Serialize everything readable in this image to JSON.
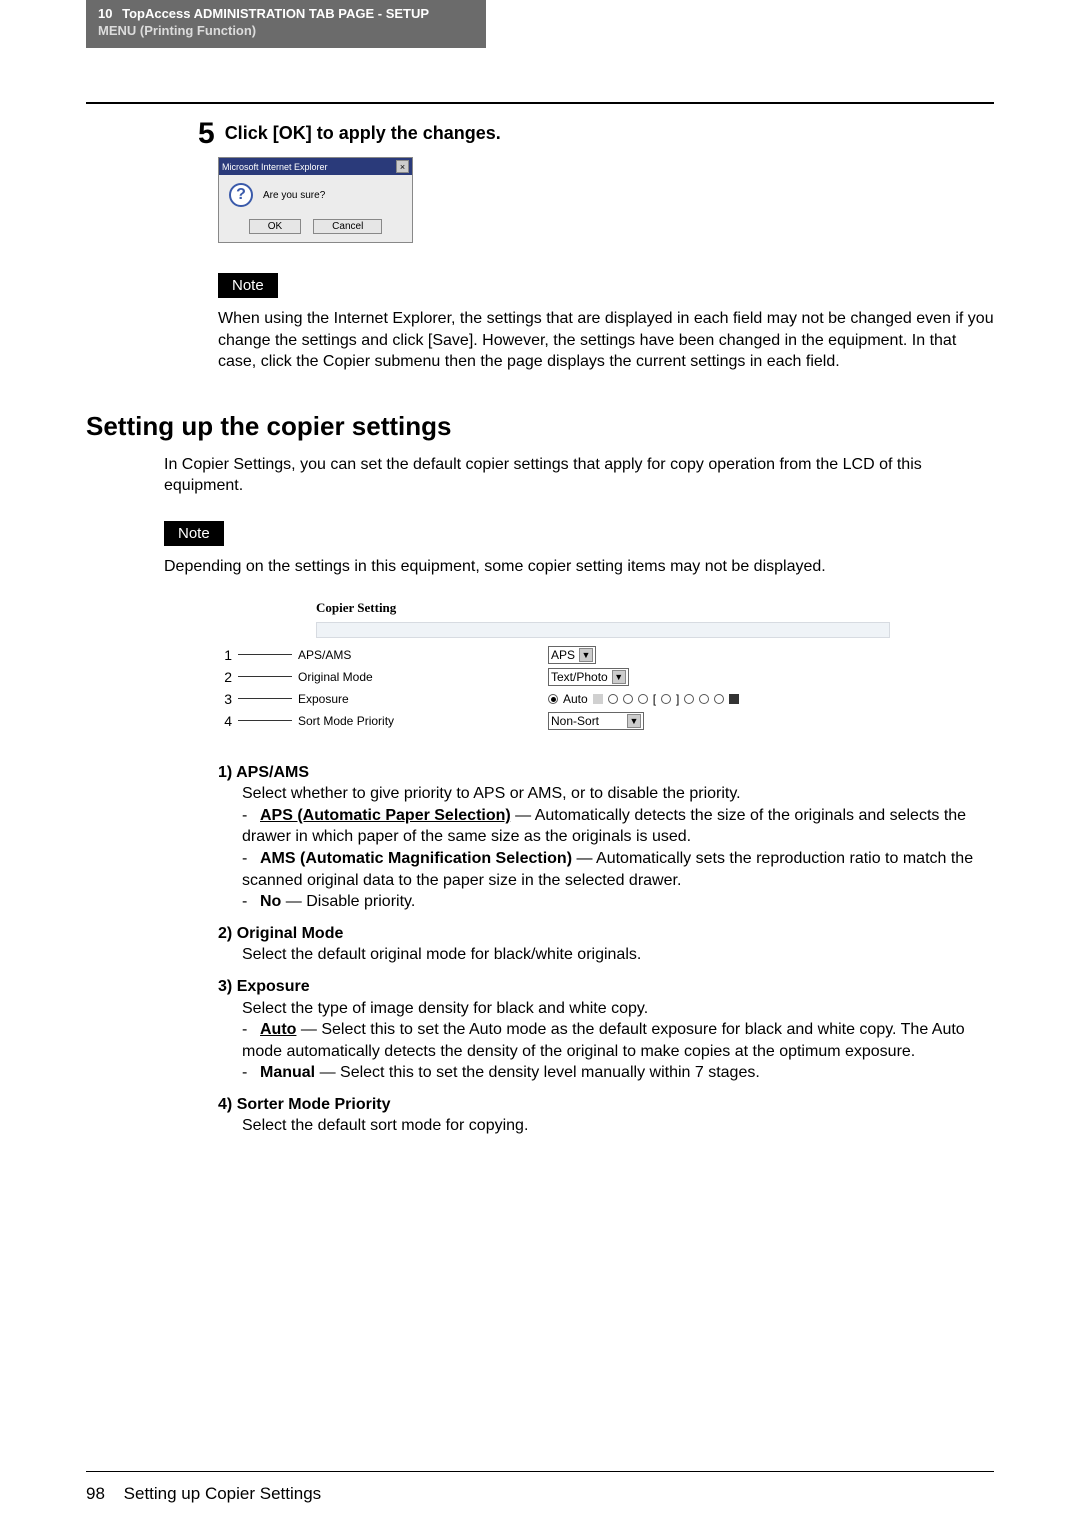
{
  "header": {
    "chapter": "10",
    "title_line1": "TopAccess ADMINISTRATION TAB PAGE - SETUP",
    "title_line2": "MENU (Printing Function)"
  },
  "step": {
    "number": "5",
    "text": "Click [OK] to apply the changes."
  },
  "dialog": {
    "title": "Microsoft Internet Explorer",
    "close": "×",
    "message": "Are you sure?",
    "ok": "OK",
    "cancel": "Cancel"
  },
  "notes": {
    "label": "Note",
    "text1": "When using the Internet Explorer, the settings that are displayed in each field may not be changed even if you change the settings and click [Save].  However, the settings have been changed in the equipment.  In that case, click the Copier submenu then the page displays the current settings in each field.",
    "text2": "Depending on the settings in this equipment, some copier setting items may not be displayed."
  },
  "section": {
    "heading": "Setting up the copier settings",
    "intro": "In Copier Settings, you can set the default copier settings that apply for copy operation from the LCD of this equipment."
  },
  "copier_panel": {
    "title": "Copier Setting",
    "rows": [
      {
        "num": "1",
        "label": "APS/AMS",
        "value": "APS"
      },
      {
        "num": "2",
        "label": "Original Mode",
        "value": "Text/Photo"
      },
      {
        "num": "3",
        "label": "Exposure",
        "value": "Auto"
      },
      {
        "num": "4",
        "label": "Sort Mode Priority",
        "value": "Non-Sort"
      }
    ]
  },
  "definitions": {
    "item1": {
      "num": "1)",
      "title": "APS/AMS",
      "text": "Select whether to give priority to APS or AMS, or to disable the priority.",
      "sub": [
        {
          "bold": "APS (Automatic Paper Selection)",
          "underline": true,
          "rest": " — Automatically detects the size of the originals and selects the drawer in which paper of the same size as the originals is used."
        },
        {
          "bold": "AMS (Automatic Magnification Selection)",
          "underline": false,
          "rest": " — Automatically sets the reproduction ratio to match the scanned original data to the paper size in the selected drawer."
        },
        {
          "bold": "No",
          "underline": false,
          "rest": " — Disable priority."
        }
      ]
    },
    "item2": {
      "num": "2)",
      "title": "Original Mode",
      "text": "Select the default original mode for black/white originals."
    },
    "item3": {
      "num": "3)",
      "title": "Exposure",
      "text": "Select the type of image density for black and white copy.",
      "sub": [
        {
          "bold": "Auto",
          "underline": true,
          "rest": " — Select this to set the Auto mode as the default exposure for black and white copy.  The Auto mode automatically detects the density of the original to make copies at the optimum exposure."
        },
        {
          "bold": "Manual",
          "underline": false,
          "rest": " — Select this to set the density level manually within 7 stages."
        }
      ]
    },
    "item4": {
      "num": "4)",
      "title": "Sorter Mode Priority",
      "text": "Select the default sort mode for copying."
    }
  },
  "footer": {
    "page": "98",
    "text": "Setting up Copier Settings"
  }
}
